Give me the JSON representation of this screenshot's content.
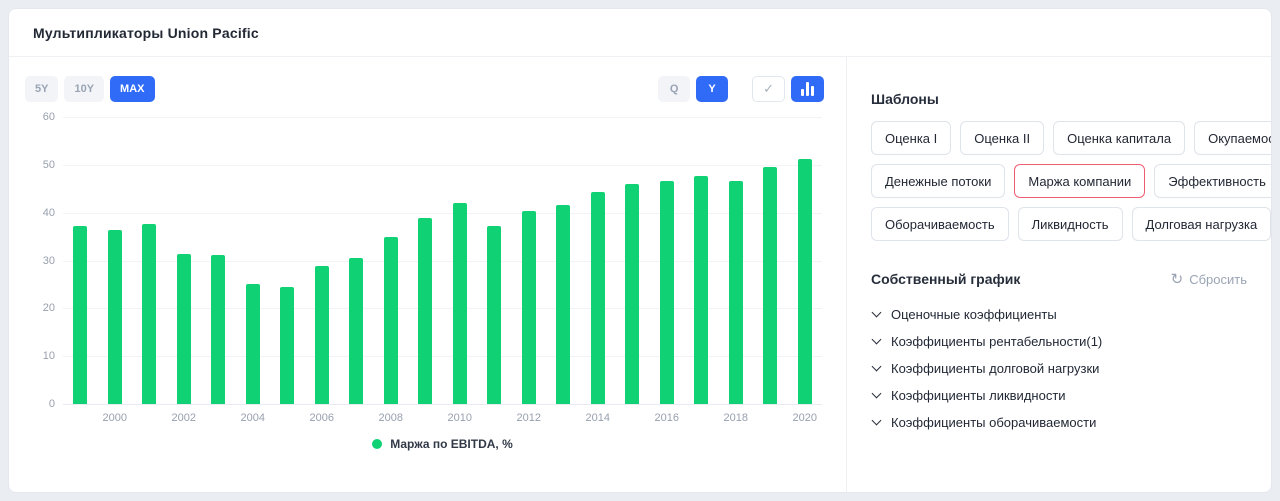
{
  "colors": {
    "accent_blue": "#2f6bf6",
    "bar_green": "#10d274",
    "active_template_border": "#ef5b70"
  },
  "icons": {
    "check": "✓",
    "reset": "↻"
  },
  "header": {
    "title": "Мультипликаторы Union Pacific"
  },
  "toolbar": {
    "ranges": [
      {
        "label": "5Y",
        "active": false
      },
      {
        "label": "10Y",
        "active": false
      },
      {
        "label": "MAX",
        "active": true
      }
    ],
    "periods": [
      {
        "label": "Q",
        "active": false
      },
      {
        "label": "Y",
        "active": true
      }
    ]
  },
  "chart_data": {
    "type": "bar",
    "title": "Маржа по EBITDA, %",
    "legend": "Маржа по EBITDA, %",
    "legend_position": "bottom",
    "grid": true,
    "bar_color": "#10d274",
    "x": [
      1999,
      2000,
      2001,
      2002,
      2003,
      2004,
      2005,
      2006,
      2007,
      2008,
      2009,
      2010,
      2011,
      2012,
      2013,
      2014,
      2015,
      2016,
      2017,
      2018,
      2019,
      2020
    ],
    "values": [
      37.2,
      36.4,
      37.6,
      31.4,
      31.2,
      25.1,
      24.5,
      28.9,
      30.5,
      34.9,
      38.9,
      42.0,
      37.3,
      40.4,
      41.7,
      44.3,
      46.0,
      46.6,
      47.7,
      46.7,
      49.5,
      51.2
    ],
    "ylim": [
      0,
      60
    ],
    "yticks": [
      0,
      10,
      20,
      30,
      40,
      50,
      60
    ],
    "xticks": [
      2000,
      2002,
      2004,
      2006,
      2008,
      2010,
      2012,
      2014,
      2016,
      2018,
      2020
    ]
  },
  "templates": {
    "title": "Шаблоны",
    "rows": [
      [
        {
          "label": "Оценка I"
        },
        {
          "label": "Оценка II"
        },
        {
          "label": "Оценка капитала"
        },
        {
          "label": "Окупаемость"
        }
      ],
      [
        {
          "label": "Денежные потоки"
        },
        {
          "label": "Маржа компании",
          "active": true
        },
        {
          "label": "Эффективность"
        }
      ],
      [
        {
          "label": "Оборачиваемость"
        },
        {
          "label": "Ликвидность"
        },
        {
          "label": "Долговая нагрузка"
        }
      ]
    ]
  },
  "custom_chart": {
    "title": "Собственный график",
    "reset_label": "Сбросить",
    "items": [
      "Оценочные коэффициенты",
      "Коэффициенты рентабельности(1)",
      "Коэффициенты долговой нагрузки",
      "Коэффициенты ликвидности",
      "Коэффициенты оборачиваемости"
    ]
  }
}
